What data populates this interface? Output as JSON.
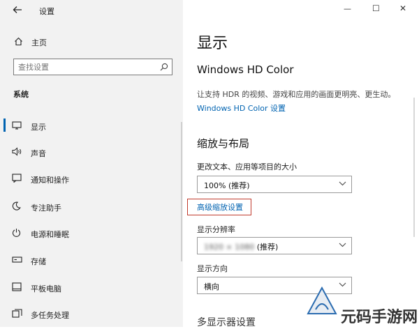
{
  "window": {
    "title": "设置",
    "controls": {
      "minimize": "—",
      "maximize": "☐",
      "close": "✕"
    }
  },
  "sidebar": {
    "home_label": "主页",
    "search_placeholder": "查找设置",
    "section_title": "系统",
    "items": [
      {
        "label": "显示",
        "icon": "monitor-icon",
        "selected": true
      },
      {
        "label": "声音",
        "icon": "speaker-icon"
      },
      {
        "label": "通知和操作",
        "icon": "notification-icon"
      },
      {
        "label": "专注助手",
        "icon": "moon-icon"
      },
      {
        "label": "电源和睡眠",
        "icon": "power-icon"
      },
      {
        "label": "存储",
        "icon": "storage-icon"
      },
      {
        "label": "平板电脑",
        "icon": "tablet-icon"
      },
      {
        "label": "多任务处理",
        "icon": "multitask-icon"
      }
    ]
  },
  "main": {
    "page_title": "显示",
    "hdr": {
      "title": "Windows HD Color",
      "description": "让支持 HDR 的视频、游戏和应用的画面更明亮、更生动。",
      "link": "Windows HD Color 设置"
    },
    "scale": {
      "title": "缩放与布局",
      "text_size_label": "更改文本、应用等项目的大小",
      "text_size_value": "100% (推荐)",
      "advanced_link": "高级缩放设置",
      "resolution_label": "显示分辨率",
      "resolution_value_blurred": "1920 × 1080",
      "resolution_suffix": " (推荐)",
      "orientation_label": "显示方向",
      "orientation_value": "横向"
    },
    "multi_display_title": "多显示器设置"
  },
  "watermark": {
    "text": "元码手游网"
  },
  "colors": {
    "accent": "#0063b1",
    "highlight_border": "#c0392b",
    "sidebar_bg": "#f2f2f2"
  }
}
